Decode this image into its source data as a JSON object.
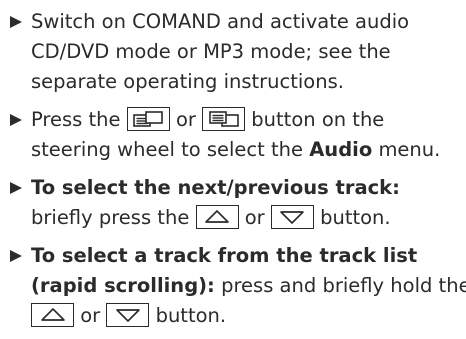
{
  "steps": [
    {
      "lines": [
        "Switch on COMAND and activate audio",
        "CD/DVD mode or MP3 mode; see the",
        "separate operating instructions."
      ]
    },
    {
      "pre": "Press the",
      "or": "or",
      "post": "button on the",
      "line2_pre": "steering wheel to select the",
      "line2_bold": "Audio",
      "line2_post": "menu.",
      "icons": [
        "page-back-icon",
        "page-forward-icon"
      ]
    },
    {
      "bold": "To select the next/previous track:",
      "pre": "briefly press the",
      "or": "or",
      "post": "button.",
      "icons": [
        "arrow-up-icon",
        "arrow-down-icon"
      ]
    },
    {
      "bold1": "To select a track from the track list",
      "bold2": "(rapid scrolling):",
      "text2": "press and briefly hold the",
      "or": "or",
      "post": "button.",
      "icons": [
        "arrow-up-icon",
        "arrow-down-icon"
      ]
    }
  ]
}
